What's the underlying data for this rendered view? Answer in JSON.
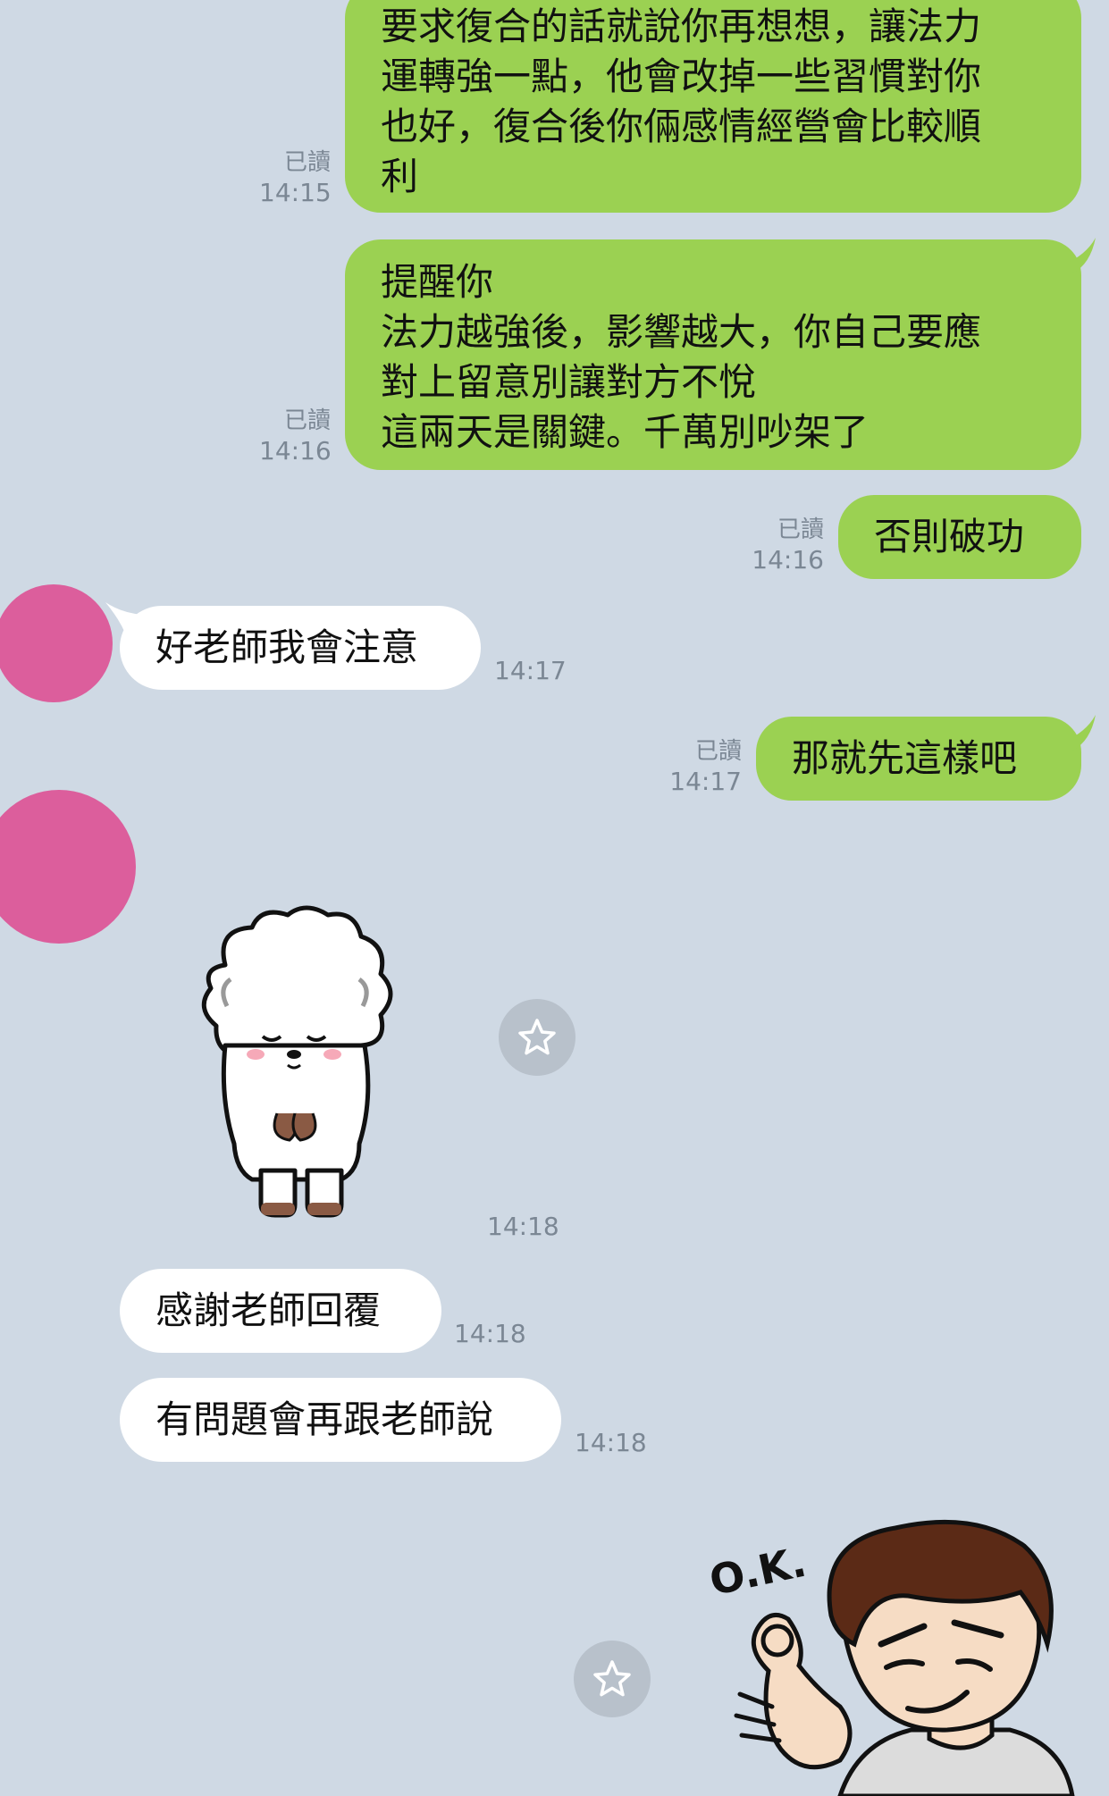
{
  "colors": {
    "background": "#cfd9e4",
    "outgoing_bubble": "#9bd152",
    "incoming_bubble": "#ffffff",
    "avatar": "#dc5e9c",
    "meta_text": "#7b8794"
  },
  "messages": [
    {
      "direction": "out",
      "text": "要求復合的話就說你再想想，讓法力\n運轉強一點，他會改掉一些習慣對你\n也好，復合後你倆感情經營會比較順\n利",
      "read": "已讀",
      "time": "14:15"
    },
    {
      "direction": "out",
      "text": "提醒你\n法力越強後，影響越大，你自己要應\n對上留意別讓對方不悅\n這兩天是關鍵。千萬別吵架了",
      "read": "已讀",
      "time": "14:16"
    },
    {
      "direction": "out",
      "text": "否則破功",
      "read": "已讀",
      "time": "14:16"
    },
    {
      "direction": "in",
      "text": "好老師我會注意",
      "time": "14:17"
    },
    {
      "direction": "out",
      "text": "那就先這樣吧",
      "read": "已讀",
      "time": "14:17"
    },
    {
      "direction": "in",
      "type": "sticker",
      "sticker": "white-sheep-bowing-sticker",
      "time": "14:18"
    },
    {
      "direction": "in",
      "text": "感謝老師回覆",
      "time": "14:18"
    },
    {
      "direction": "in",
      "text": "有問題會再跟老師說",
      "time": "14:18"
    },
    {
      "direction": "out",
      "type": "sticker",
      "sticker": "ok-gesture-boy-sticker",
      "sticker_text": "O.K."
    }
  ],
  "icons": {
    "favorite": "star-icon"
  }
}
